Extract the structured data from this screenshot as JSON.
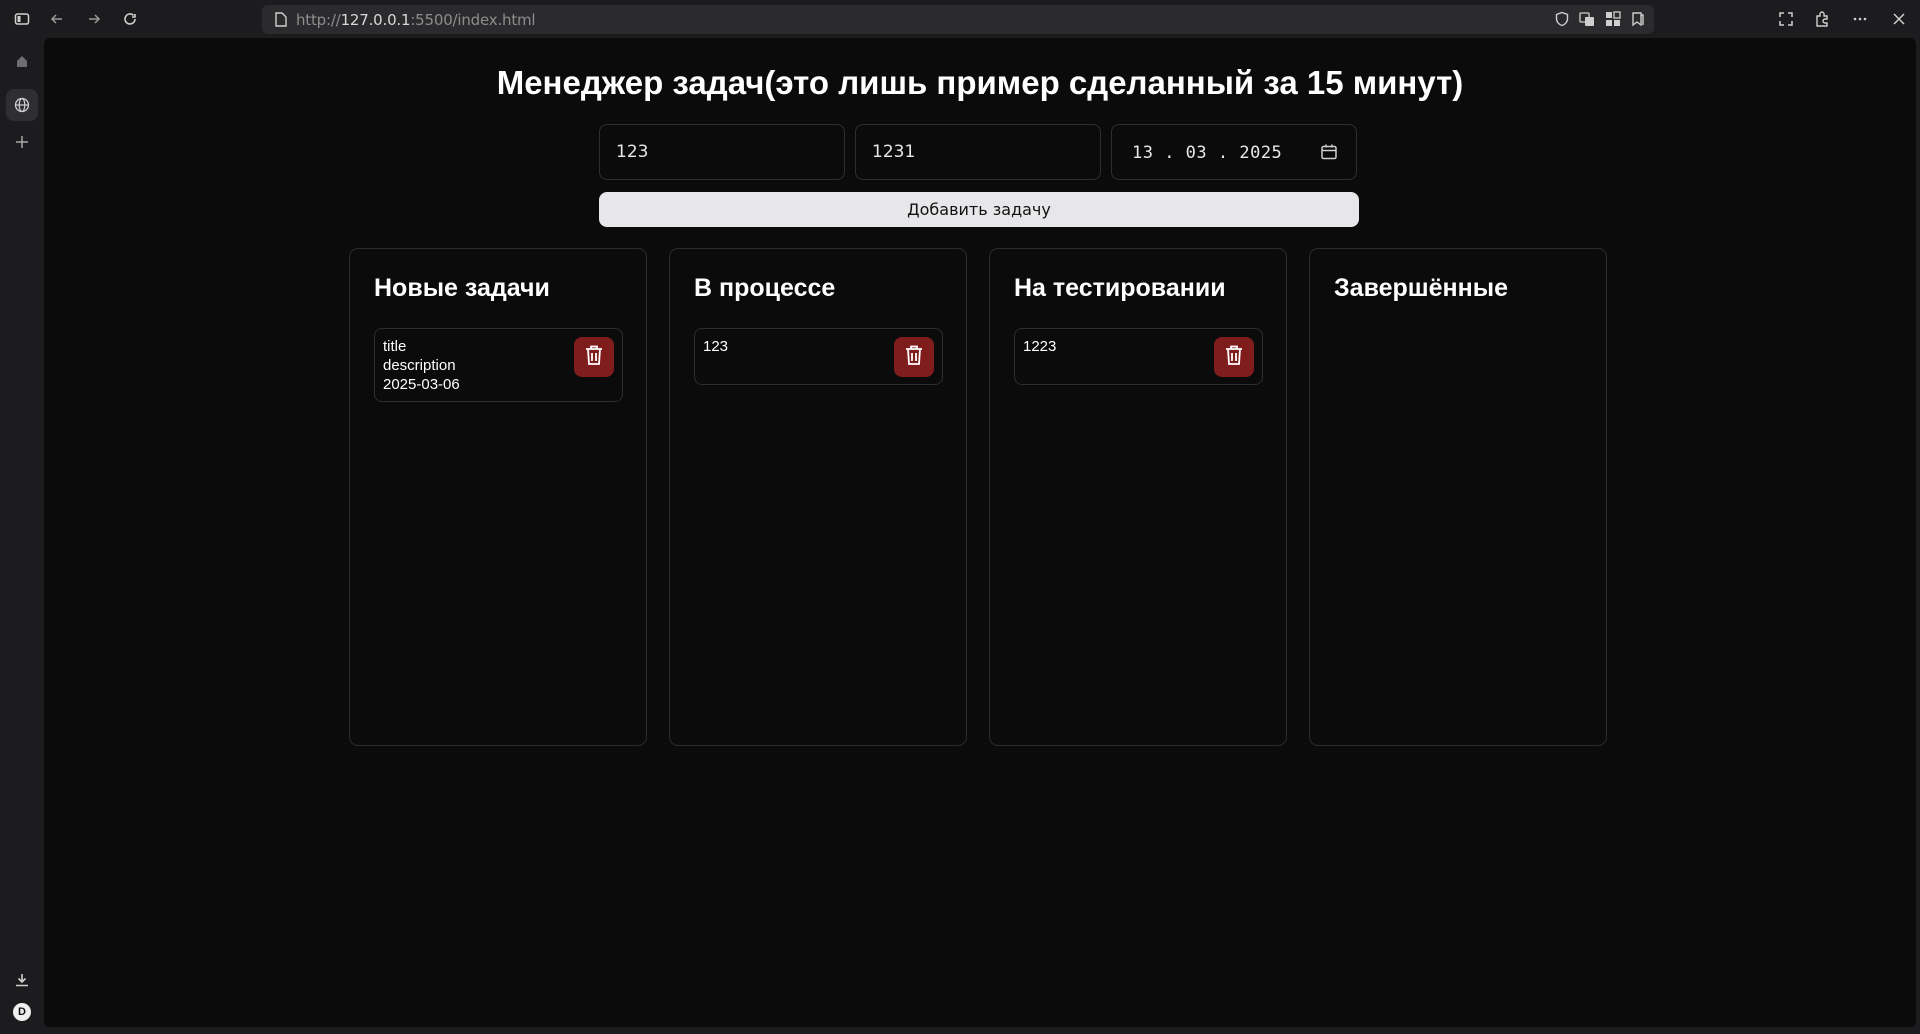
{
  "browser": {
    "url_scheme": "http://",
    "url_host": "127.0.0.1",
    "url_rest": ":5500/index.html",
    "profile_initial": "D"
  },
  "app": {
    "title": "Менеджер задач(это лишь пример сделанный за 15 минут)",
    "inputs": {
      "title_value": "123",
      "description_value": "1231",
      "date_display": "13 . 03 . 2025"
    },
    "add_button_label": "Добавить задачу"
  },
  "columns": [
    {
      "title": "Новые задачи",
      "tasks": [
        {
          "title": "title",
          "description": "description",
          "date": "2025-03-06"
        }
      ]
    },
    {
      "title": "В процессе",
      "tasks": [
        {
          "title": "123"
        }
      ]
    },
    {
      "title": "На тестировании",
      "tasks": [
        {
          "title": "1223"
        }
      ]
    },
    {
      "title": "Завершённые",
      "tasks": []
    }
  ],
  "colors": {
    "background": "#0b0b0c",
    "delete_button": "#7f1d1d",
    "add_button": "#e7e7ea"
  }
}
